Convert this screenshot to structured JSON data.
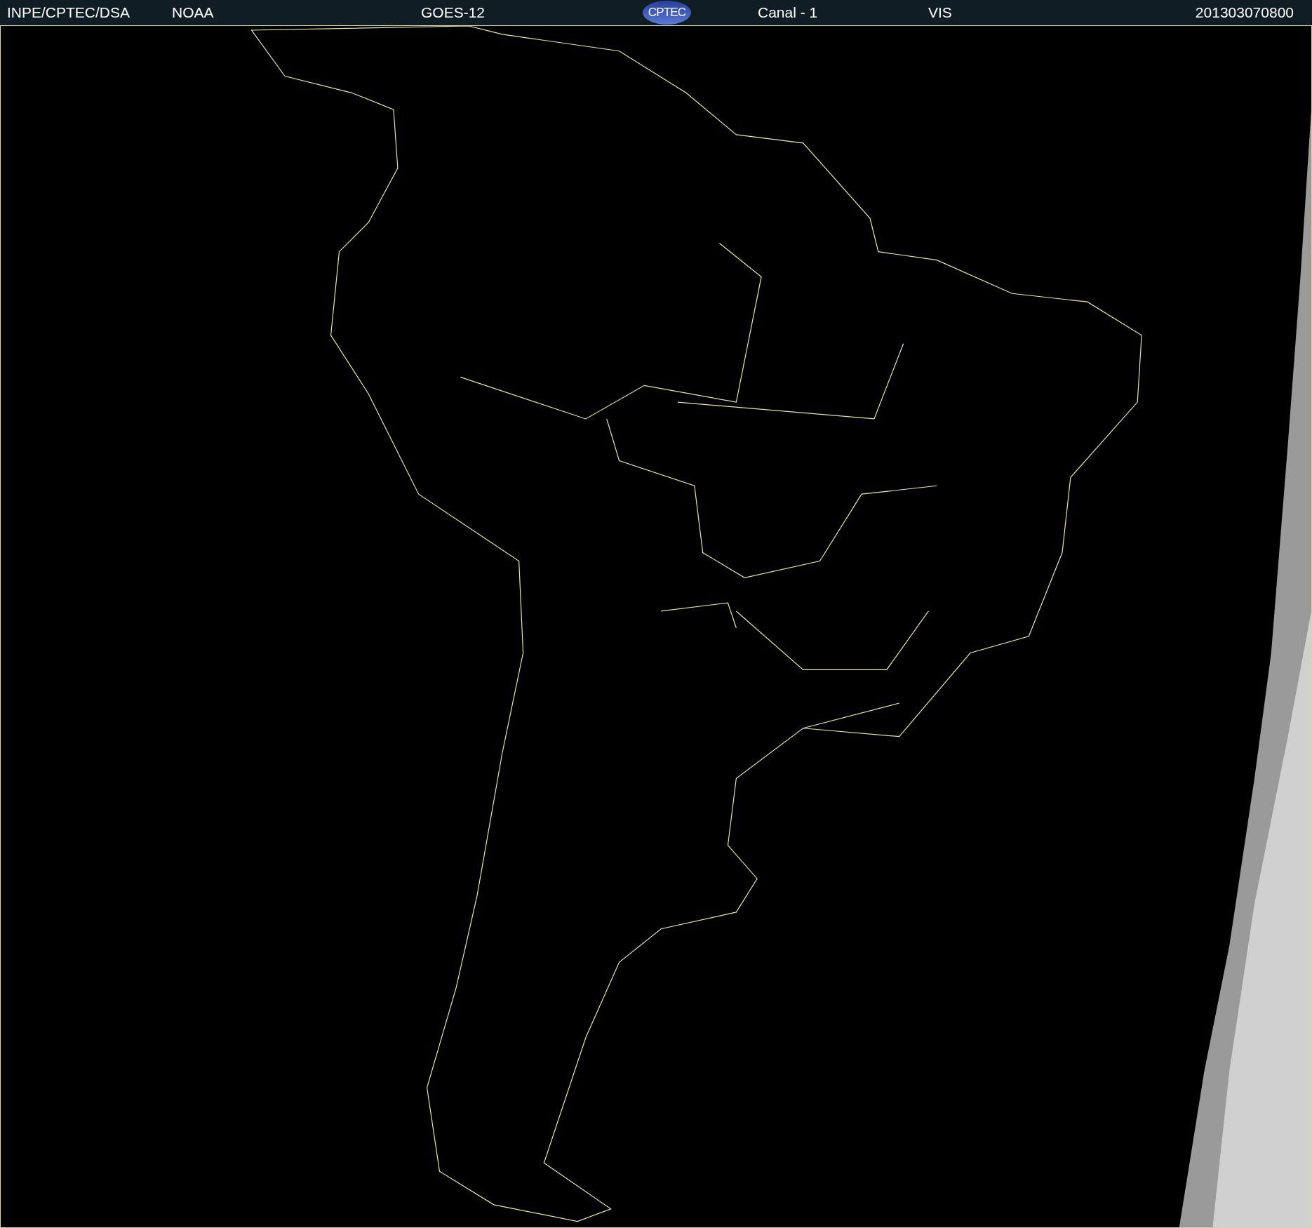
{
  "header": {
    "source": "INPE/CPTEC/DSA",
    "agency": "NOAA",
    "satellite": "GOES-12",
    "logo": "CPTEC",
    "channel": "Canal - 1",
    "band": "VIS",
    "timestamp": "201303070800"
  }
}
